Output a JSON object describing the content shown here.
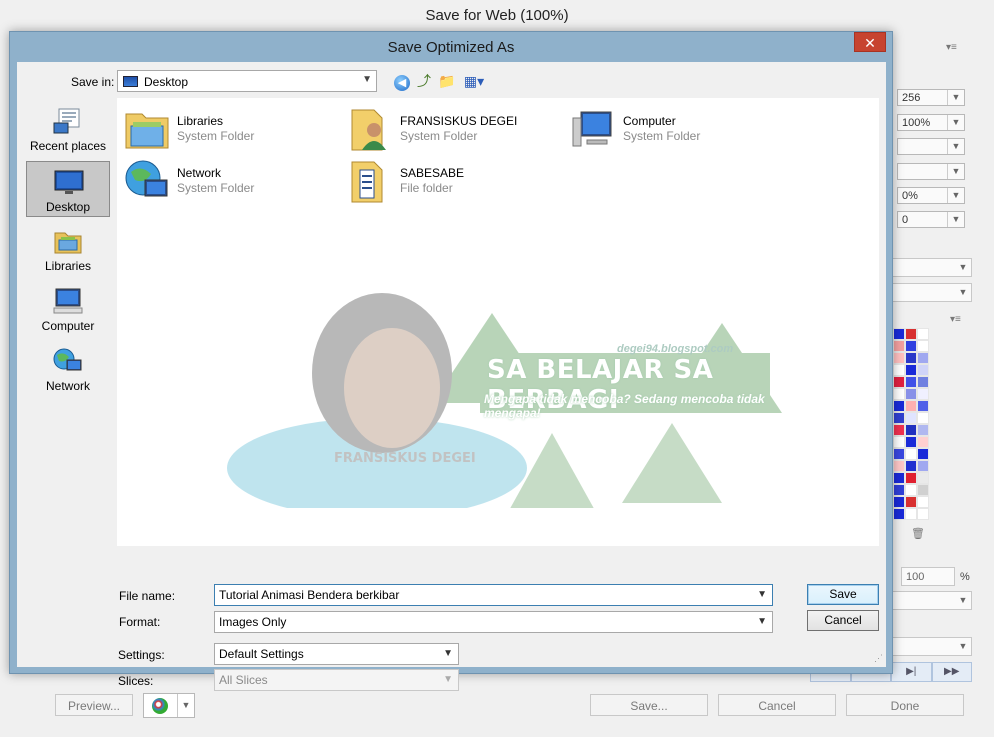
{
  "parent_window": {
    "title": "Save for Web (100%)",
    "right_panel_fields": [
      "256",
      "100%",
      "",
      "",
      "0%",
      "0"
    ],
    "quality_label": "",
    "quality_value": "100",
    "quality_unit": "%",
    "buttons": {
      "preview": "Preview...",
      "save": "Save...",
      "cancel": "Cancel",
      "done": "Done"
    }
  },
  "dialog": {
    "title": "Save Optimized As",
    "close_glyph": "✕",
    "save_in": {
      "label": "Save in:",
      "value": "Desktop"
    },
    "places": [
      {
        "label": "Recent places",
        "icon": "recent-places-icon"
      },
      {
        "label": "Desktop",
        "icon": "desktop-icon",
        "selected": true
      },
      {
        "label": "Libraries",
        "icon": "libraries-icon"
      },
      {
        "label": "Computer",
        "icon": "computer-icon"
      },
      {
        "label": "Network",
        "icon": "network-icon"
      }
    ],
    "files": [
      {
        "name": "Libraries",
        "type": "System Folder",
        "icon": "libraries-folder-icon"
      },
      {
        "name": "FRANSISKUS DEGEI",
        "type": "System Folder",
        "icon": "user-folder-icon"
      },
      {
        "name": "Computer",
        "type": "System Folder",
        "icon": "computer-icon"
      },
      {
        "name": "Network",
        "type": "System Folder",
        "icon": "network-globe-icon"
      },
      {
        "name": "SABESABE",
        "type": "File folder",
        "icon": "folder-icon"
      }
    ],
    "watermark": {
      "url": "degei94.blogspot.com",
      "headline": "SA BELAJAR SA BERBAGI",
      "tagline": "Mengapa tidak mencoba? Sedang mencoba tidak mengapa!",
      "name": "FRANSISKUS DEGEI"
    },
    "form": {
      "file_name_label": "File name:",
      "file_name_value": "Tutorial Animasi Bendera berkibar",
      "format_label": "Format:",
      "format_value": "Images Only",
      "settings_label": "Settings:",
      "settings_value": "Default Settings",
      "slices_label": "Slices:",
      "slices_value": "All Slices"
    },
    "buttons": {
      "save": "Save",
      "cancel": "Cancel"
    }
  },
  "colors": {
    "dialog_frame": "#8fb1cb",
    "close_button": "#c7432f",
    "selection": "#c8c8c8"
  }
}
